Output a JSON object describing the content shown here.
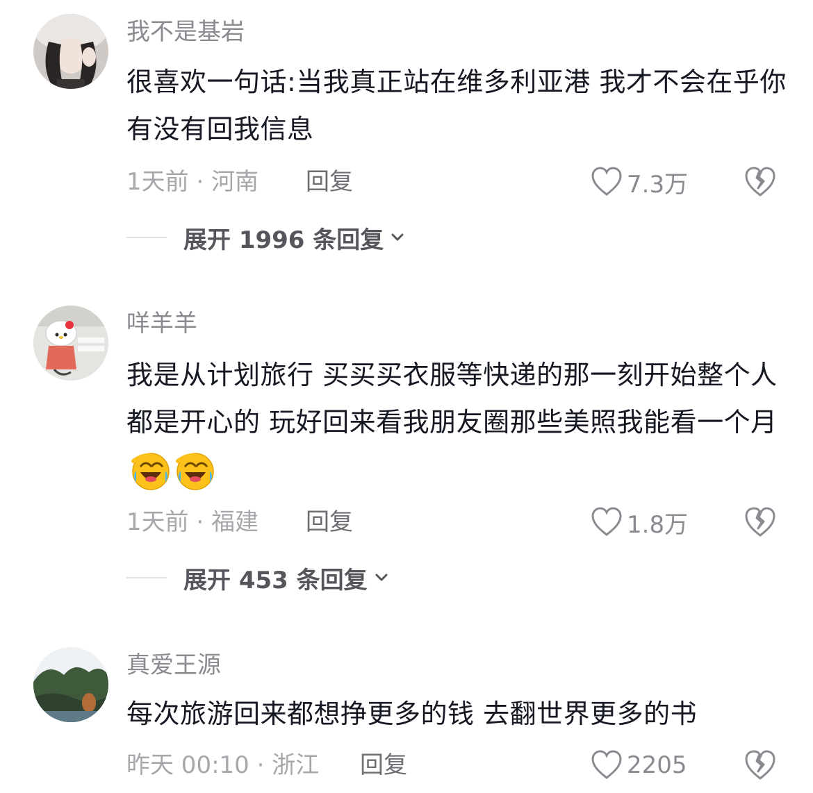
{
  "comments": [
    {
      "username": "我不是基岩",
      "content": "很喜欢一句话:当我真正站在维多利亚港 我才不会在乎你有没有回我信息",
      "meta": "1天前 · 河南",
      "reply": "回复",
      "likes": "7.3万",
      "expand": "展开 1996 条回复"
    },
    {
      "username": "咩羊羊",
      "content": "我是从计划旅行 买买买衣服等快递的那一刻开始整个人都是开心的  玩好回来看我朋友圈那些美照我能看一个月",
      "emojis": [
        "laugh-cry-emoji",
        "laugh-cry-emoji"
      ],
      "meta": "1天前 · 福建",
      "reply": "回复",
      "likes": "1.8万",
      "expand": "展开 453 条回复"
    },
    {
      "username": "真爱王源",
      "content": "每次旅游回来都想挣更多的钱 去翻世界更多的书",
      "meta": "昨天 00:10 · 浙江",
      "reply": "回复",
      "likes": "2205"
    }
  ],
  "colors": {
    "username": "#8a8b91",
    "meta": "#a6a7ab",
    "text": "#161823"
  }
}
